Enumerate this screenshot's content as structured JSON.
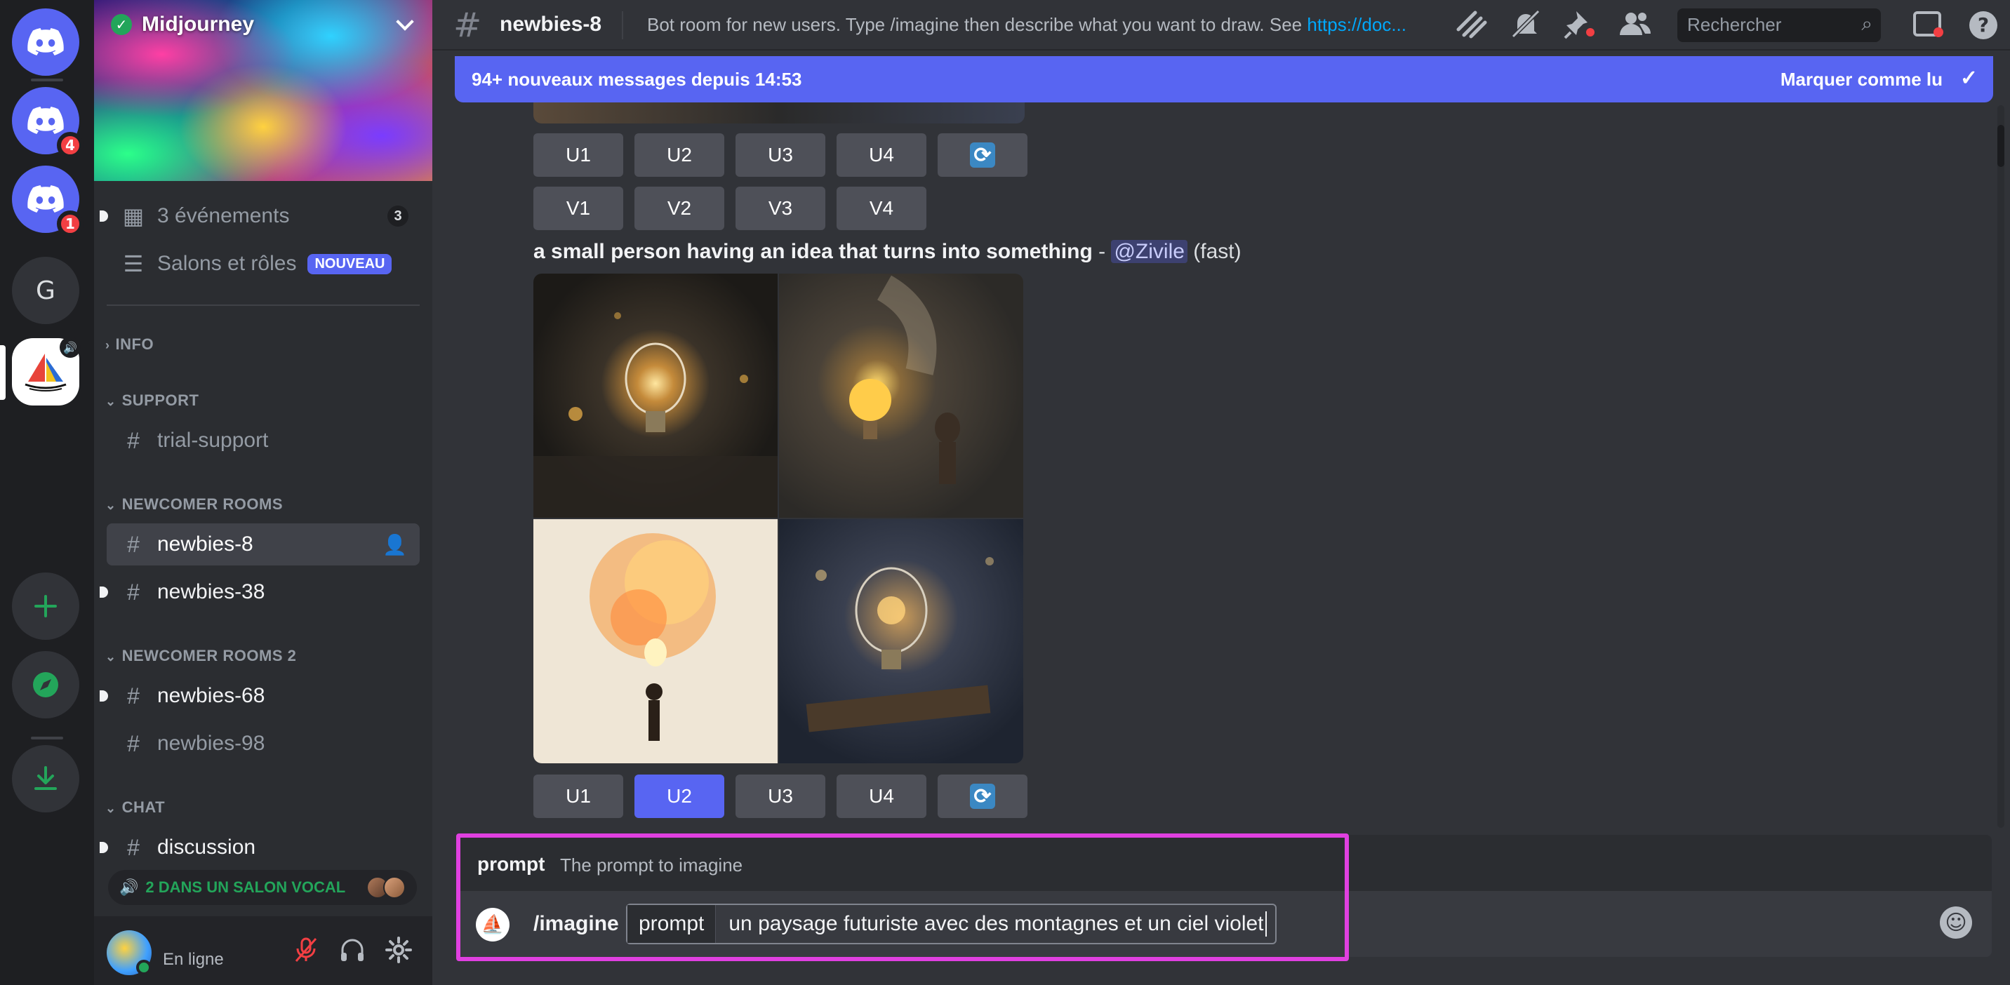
{
  "servers": {
    "home_badge": "",
    "server1_badge": "4",
    "server2_badge": "1",
    "server3_letter": "G"
  },
  "sidebar": {
    "server_name": "Midjourney",
    "events_label": "3 événements",
    "events_count": "3",
    "channels_roles_label": "Salons et rôles",
    "new_badge": "NOUVEAU",
    "categories": {
      "info": "INFO",
      "support": "SUPPORT",
      "newcomer_rooms": "NEWCOMER ROOMS",
      "newcomer_rooms_2": "NEWCOMER ROOMS 2",
      "chat": "CHAT"
    },
    "channels": {
      "trial_support": "trial-support",
      "newbies_8": "newbies-8",
      "newbies_38": "newbies-38",
      "newbies_68": "newbies-68",
      "newbies_98": "newbies-98",
      "discussion": "discussion"
    },
    "voice_strip": "2 DANS UN SALON VOCAL",
    "user_status": "En ligne"
  },
  "header": {
    "channel_name": "newbies-8",
    "topic_text": "Bot room for new users. Type /imagine then describe what you want to draw. See ",
    "topic_link": "https://doc...",
    "search_placeholder": "Rechercher"
  },
  "new_messages": {
    "label": "94+ nouveaux messages depuis 14:53",
    "mark_read": "Marquer comme lu"
  },
  "messages": {
    "upscale_buttons": [
      "U1",
      "U2",
      "U3",
      "U4"
    ],
    "variation_buttons": [
      "V1",
      "V2",
      "V3",
      "V4"
    ],
    "prompt_bold": "a small person having an idea that turns into something",
    "separator": " - ",
    "mention": "@Zivile",
    "speed": " (fast)"
  },
  "command": {
    "option_name": "prompt",
    "option_desc": "The prompt to imagine",
    "command_name": "/imagine",
    "field_label": "prompt",
    "field_value": "un paysage futuriste avec des montagnes et un ciel violet"
  },
  "colors": {
    "accent": "#5865f2",
    "highlight": "#e040e0",
    "online": "#23a55a"
  }
}
